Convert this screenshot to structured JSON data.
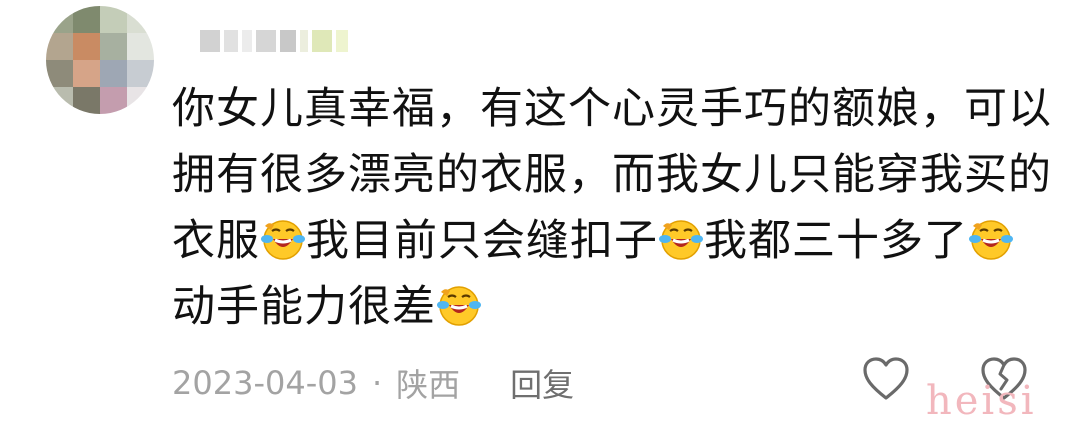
{
  "comment": {
    "content": {
      "line1": "你女儿真幸福，有这个心灵手巧的额娘，可以",
      "line2": "拥有很多漂亮的衣服，而我女儿只能穿我买的",
      "line3_a": "衣服",
      "line3_b": "我目前只会缝扣子",
      "line3_c": "我都三十多了",
      "line4_a": "动手能力很差",
      "emoji_icon": "laugh-cry-emoji"
    },
    "meta": {
      "date": "2023-04-03",
      "separator": "·",
      "location": "陕西",
      "reply_label": "回复"
    },
    "actions": {
      "like_icon": "heart-outline-icon",
      "dislike_icon": "broken-heart-outline-icon"
    },
    "watermark": "heisi"
  },
  "colors": {
    "text": "#111111",
    "meta": "#a3a3a3",
    "watermark": "#f2b7bd"
  }
}
